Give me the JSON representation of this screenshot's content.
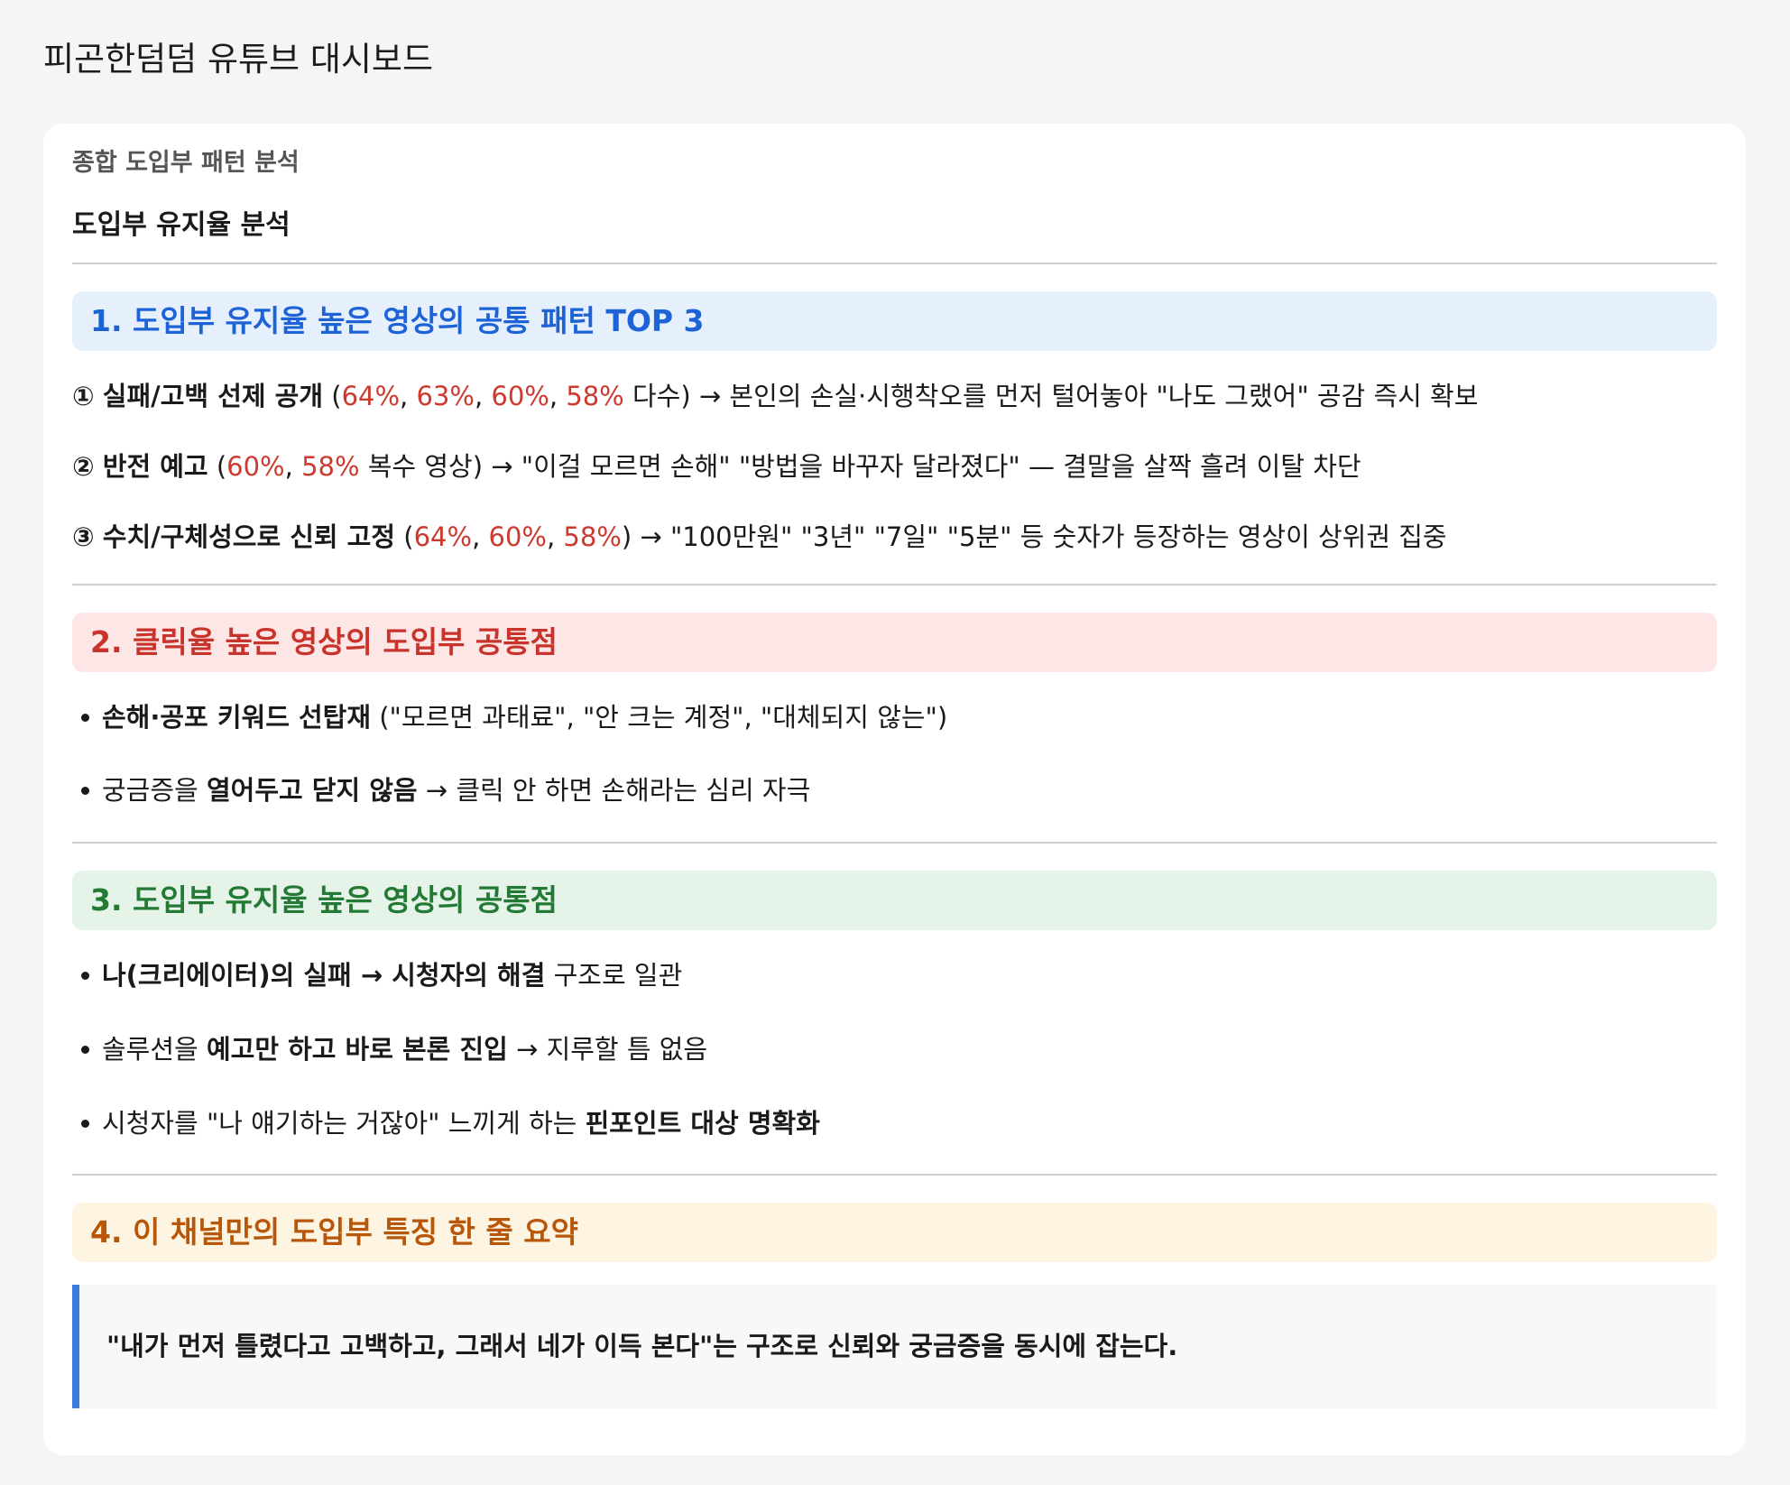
{
  "page": {
    "title": "피곤한덤덤 유튜브 대시보드"
  },
  "card": {
    "subtitle": "종합 도입부 패턴 분석",
    "heading": "도입부 유지율 분석"
  },
  "section1": {
    "title": "1. 도입부 유지율 높은 영상의 공통 패턴 TOP 3",
    "items": [
      {
        "marker": "①",
        "bold": "실패/고백 선제 공개",
        "open": " (",
        "nums": [
          "64%",
          "63%",
          "60%",
          "58%"
        ],
        "after_nums": " 다수)",
        "rest": " → 본인의 손실·시행착오를 먼저 털어놓아 \"나도 그랬어\" 공감 즉시 확보"
      },
      {
        "marker": "②",
        "bold": "반전 예고",
        "open": " (",
        "nums": [
          "60%",
          "58%"
        ],
        "after_nums": " 복수 영상)",
        "rest": " → \"이걸 모르면 손해\" \"방법을 바꾸자 달라졌다\" — 결말을 살짝 흘려 이탈 차단"
      },
      {
        "marker": "③",
        "bold": "수치/구체성으로 신뢰 고정",
        "open": " (",
        "nums": [
          "64%",
          "60%",
          "58%"
        ],
        "after_nums": ")",
        "rest": " → \"100만원\" \"3년\" \"7일\" \"5분\" 등 숫자가 등장하는 영상이 상위권 집중"
      }
    ]
  },
  "section2": {
    "title": "2. 클릭율 높은 영상의 도입부 공통점",
    "bullets": [
      {
        "bold": "손해·공포 키워드 선탑재",
        "rest": " (\"모르면 과태료\", \"안 크는 계정\", \"대체되지 않는\")"
      },
      {
        "pre": "궁금증을 ",
        "bold": "열어두고 닫지 않음",
        "rest": " → 클릭 안 하면 손해라는 심리 자극"
      }
    ]
  },
  "section3": {
    "title": "3. 도입부 유지율 높은 영상의 공통점",
    "bullets": [
      {
        "bold": "나(크리에이터)의 실패 → 시청자의 해결",
        "rest": " 구조로 일관"
      },
      {
        "pre": "솔루션을 ",
        "bold": "예고만 하고 바로 본론 진입",
        "rest": " → 지루할 틈 없음"
      },
      {
        "pre": "시청자를 \"나 얘기하는 거잖아\" 느끼게 하는 ",
        "bold": "핀포인트 대상 명확화",
        "rest": ""
      }
    ]
  },
  "section4": {
    "title": "4. 이 채널만의 도입부 특징 한 줄 요약",
    "quote": "\"내가 먼저 틀렸다고 고백하고, 그래서 네가 이득 본다\"는 구조로 신뢰와 궁금증을 동시에 잡는다."
  },
  "colors": {
    "accent_blue": "#1e63d6",
    "accent_red": "#c8342b",
    "accent_green": "#237a35",
    "accent_orange": "#b8570a",
    "number_red": "#cc3a2f",
    "quote_border": "#3b7ae0"
  }
}
